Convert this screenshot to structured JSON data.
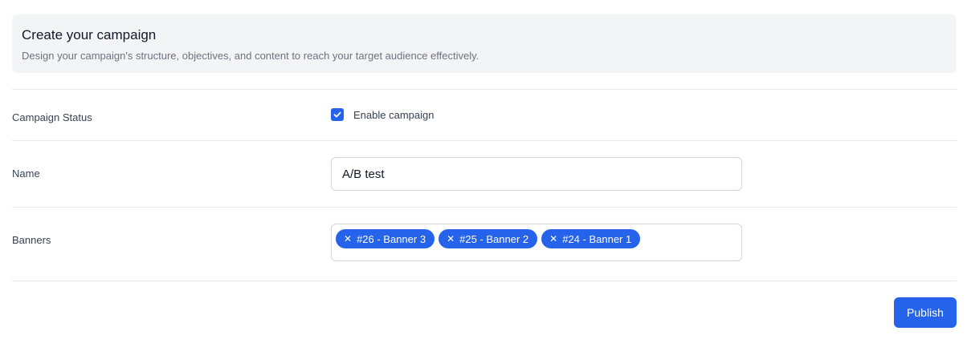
{
  "header": {
    "title": "Create your campaign",
    "subtitle": "Design your campaign's structure, objectives, and content to reach your target audience effectively."
  },
  "form": {
    "status": {
      "label": "Campaign Status",
      "checkbox_label": "Enable campaign",
      "checked": true
    },
    "name": {
      "label": "Name",
      "value": "A/B test"
    },
    "banners": {
      "label": "Banners",
      "tags": [
        "#26 - Banner 3",
        "#25 - Banner 2",
        "#24 - Banner 1"
      ]
    }
  },
  "actions": {
    "publish_label": "Publish"
  },
  "theme": {
    "accent": "#2563eb",
    "header_bg": "#f3f4f6",
    "divider": "#e5e7eb"
  },
  "icons": {
    "checkbox": "check-icon",
    "tag_remove": "close-icon"
  }
}
